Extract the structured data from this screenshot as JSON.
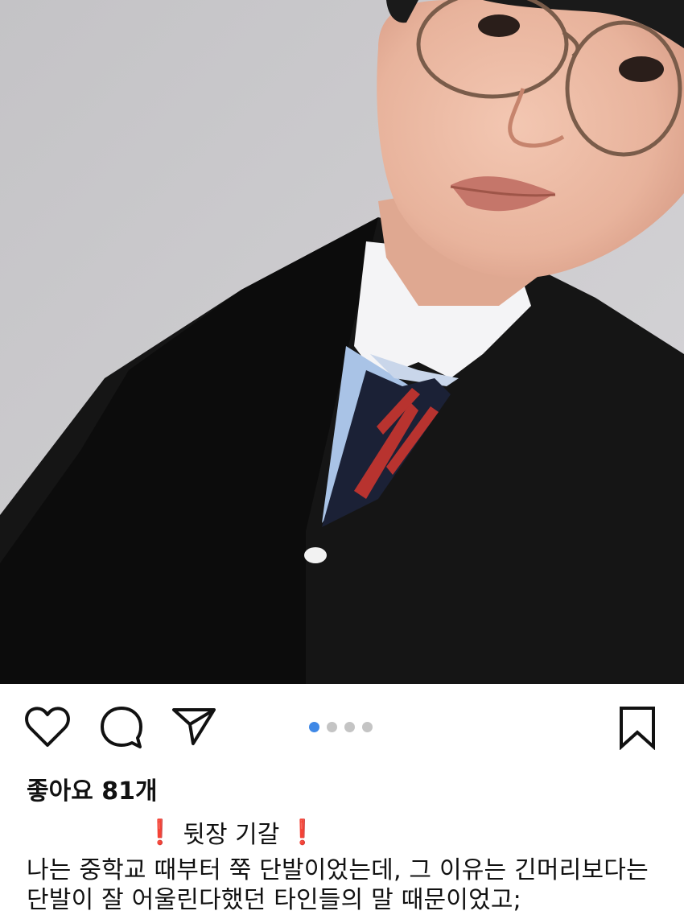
{
  "post": {
    "likes_text": "좋아요 81개",
    "caption_title": "뒷장 기갈",
    "caption_title_marker": "❗",
    "caption_lines": [
      "나는 중학교 때부터 쭉 단발이었는데, 그 이유는 긴머리보다는",
      "단발이 잘 어울린다했던 타인들의 말 때문이었고;"
    ]
  },
  "pager": {
    "total": 4,
    "active_index": 0
  },
  "icons": {
    "like": "heart-icon",
    "comment": "comment-icon",
    "share": "send-icon",
    "save": "bookmark-icon"
  },
  "colors": {
    "background": "#ffffff",
    "text": "#111111",
    "pager_active": "#3f88e6",
    "pager_inactive": "#c4c4c4",
    "exclamation": "#e0262a"
  }
}
